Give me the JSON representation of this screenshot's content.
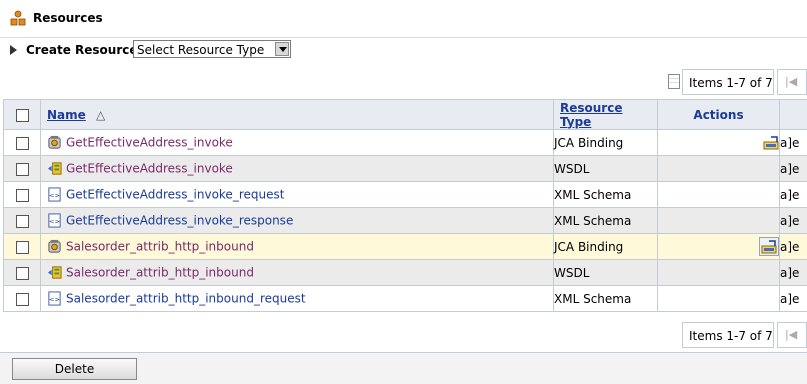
{
  "header": {
    "title": "Resources",
    "icon": "resources-icon"
  },
  "create": {
    "label": "Create Resource:",
    "select_value": "Select Resource Type"
  },
  "pager": {
    "range_text": "Items 1-7 of 7",
    "first_symbol": "|◀"
  },
  "columns": {
    "name": "Name",
    "type": "Resource Type",
    "actions": "Actions",
    "sort_symbol": "△"
  },
  "rows": [
    {
      "name": "GetEffectiveAddress_invoke",
      "type": "JCA Binding",
      "icon": "jca-binding-icon",
      "action": true,
      "extra": "a]e"
    },
    {
      "name": "GetEffectiveAddress_invoke",
      "type": "WSDL",
      "icon": "wsdl-icon",
      "action": false,
      "extra": "a]e"
    },
    {
      "name": "GetEffectiveAddress_invoke_request",
      "type": "XML Schema",
      "icon": "xml-schema-icon",
      "action": false,
      "extra": "a]e"
    },
    {
      "name": "GetEffectiveAddress_invoke_response",
      "type": "XML Schema",
      "icon": "xml-schema-icon",
      "action": false,
      "extra": "a]e"
    },
    {
      "name": "Salesorder_attrib_http_inbound",
      "type": "JCA Binding",
      "icon": "jca-binding-icon",
      "action": true,
      "extra": "a]e"
    },
    {
      "name": "Salesorder_attrib_http_inbound",
      "type": "WSDL",
      "icon": "wsdl-icon",
      "action": false,
      "extra": "a]e"
    },
    {
      "name": "Salesorder_attrib_http_inbound_request",
      "type": "XML Schema",
      "icon": "xml-schema-icon",
      "action": false,
      "extra": "a]e"
    }
  ],
  "footer": {
    "delete_label": "Delete"
  }
}
